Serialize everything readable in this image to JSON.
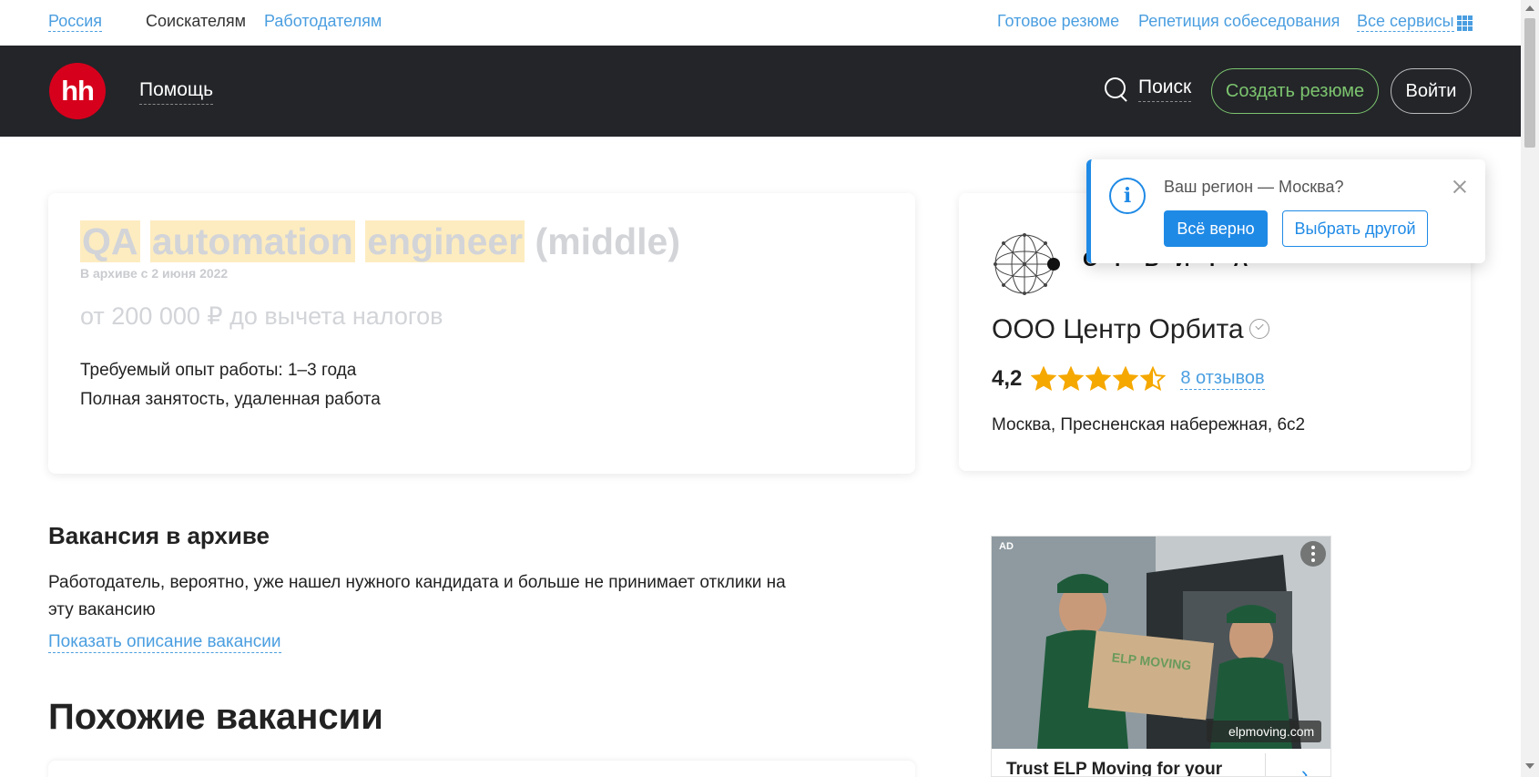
{
  "topbar": {
    "region": "Россия",
    "applicants": "Соискателям",
    "employers": "Работодателям",
    "ready_resume": "Готовое резюме",
    "interview_rehearsal": "Репетиция собеседования",
    "all_services": "Все сервисы"
  },
  "header": {
    "logo": "hh",
    "help": "Помощь",
    "search": "Поиск",
    "create_resume": "Создать резюме",
    "login": "Войти"
  },
  "vacancy": {
    "title_words": [
      "QA",
      "automation",
      "engineer"
    ],
    "title_rest": "(middle)",
    "archived_since": "В архиве с 2 июня 2022",
    "salary": "от 200 000 ₽ до вычета налогов",
    "experience": "Требуемый опыт работы: 1–3 года",
    "employment": "Полная занятость, удаленная работа"
  },
  "company": {
    "logo_word": "ОРБИТА",
    "name": "ООО Центр Орбита",
    "rating": "4,2",
    "rating_stars": 4.5,
    "reviews": "8 отзывов",
    "address": "Москва, Пресненская набережная, 6с2"
  },
  "region_popup": {
    "question": "Ваш регион — Москва?",
    "confirm": "Всё верно",
    "choose_other": "Выбрать другой"
  },
  "archive": {
    "title": "Вакансия в архиве",
    "text": "Работодатель, вероятно, уже нашел нужного кандидата и больше не принимает отклики на эту вакансию",
    "show_description": "Показать описание вакансии"
  },
  "similar": {
    "title": "Похожие вакансии"
  },
  "ad": {
    "badge": "AD",
    "box_text": "ELP MOVING",
    "brand": "elpmoving.com",
    "headline": "Trust ELP Moving for your",
    "arrow": "›"
  },
  "colors": {
    "accent": "#4a9ee0",
    "header_bg": "#232529",
    "logo_red": "#d6001c",
    "create_green": "#7cc46e",
    "star": "#f5a800"
  }
}
